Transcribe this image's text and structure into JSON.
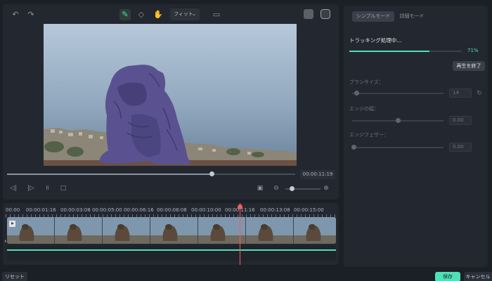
{
  "toolbar": {
    "undo_icon": "undo-icon",
    "redo_icon": "redo-icon",
    "fit_label": "フィット"
  },
  "player": {
    "timecode": "00:00:11:19",
    "seek_progress": 0.71
  },
  "timeline": {
    "ruler": [
      "00:00",
      "00:00:01:16",
      "00:00:03:08",
      "00:00:05:00",
      "00:00:06:16",
      "00:00:08:08",
      "00:00:10:00",
      "00:00:11:16",
      "00:00:13:08",
      "00:00:15:00"
    ]
  },
  "right_panel": {
    "tabs": [
      "シンプルモード",
      "詳細モード"
    ],
    "status_title": "トラッキング処理中...",
    "progress_pct": "71%",
    "progress_value": 0.71,
    "stop_button": "再生を終了",
    "brush_size_label": "ブラシサイズ：",
    "brush_size_value": "14",
    "edge_thickness_label": "エッジの幅：",
    "edge_thickness_value": "0.00",
    "edge_feather_label": "エッジフェザー：",
    "edge_feather_value": "0.00"
  },
  "footer": {
    "reset": "リセット",
    "save": "保存",
    "cancel": "キャンセル"
  },
  "colors": {
    "accent": "#4fe0b5",
    "playhead": "#ff5a5a"
  }
}
